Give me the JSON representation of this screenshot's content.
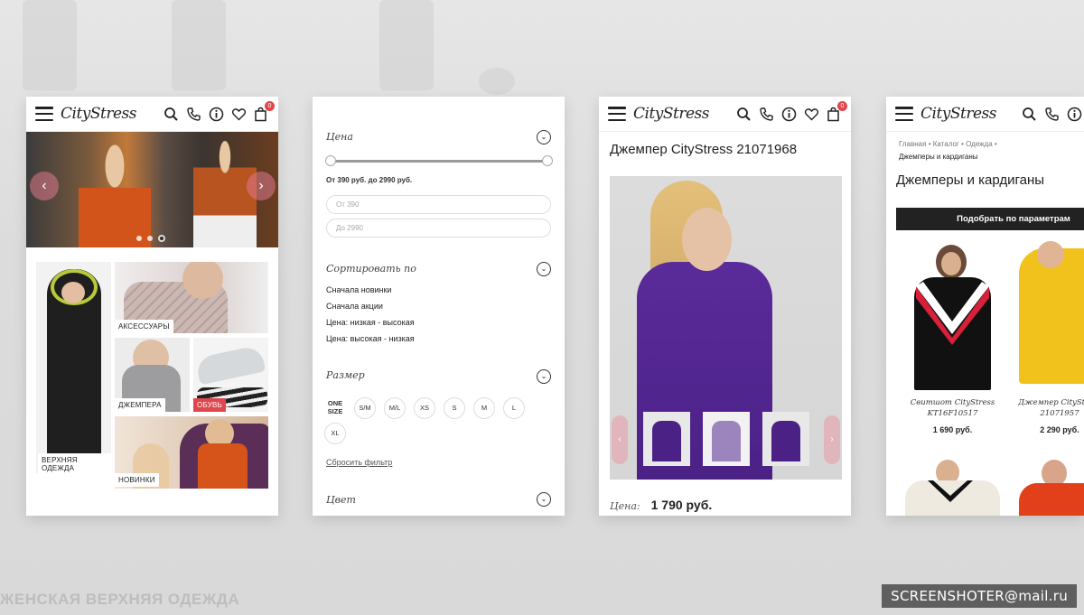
{
  "app": {
    "logo": "CityStress",
    "cart_count": "0"
  },
  "background": {
    "caption": "ЖЕНСКАЯ ВЕРХНЯЯ ОДЕЖДА",
    "watermark": "SCREENSHOTER@mail.ru"
  },
  "home": {
    "slider": {
      "prev": "‹",
      "next": "›",
      "slides": 3,
      "active_slide": 3
    },
    "tiles": [
      {
        "label": "ВЕРХНЯЯ ОДЕЖДА"
      },
      {
        "label": "АКСЕССУАРЫ"
      },
      {
        "label": "ДЖЕМПЕРА"
      },
      {
        "label": "ОБУВЬ"
      },
      {
        "label": "НОВИНКИ"
      }
    ]
  },
  "filters": {
    "price": {
      "title": "Цена",
      "range_text": "От 390 руб. до 2990 руб.",
      "from_placeholder": "От 390",
      "to_placeholder": "До 2990",
      "min": 390,
      "max": 2990
    },
    "sort": {
      "title": "Сортировать по",
      "options": [
        "Сначала новинки",
        "Сначала акции",
        "Цена: низкая - высокая",
        "Цена: высокая - низкая"
      ]
    },
    "size": {
      "title": "Размер",
      "options": [
        "ONE SIZE",
        "S/M",
        "M/L",
        "XS",
        "S",
        "M",
        "L",
        "XL"
      ]
    },
    "reset": "Сбросить фильтр",
    "color": {
      "title": "Цвет"
    }
  },
  "product": {
    "title": "Джемпер CityStress 21071968",
    "price_label": "Цена:",
    "price": "1 790 руб.",
    "prev": "‹",
    "next": "›"
  },
  "catalog": {
    "breadcrumbs": [
      "Главная",
      "Каталог",
      "Одежда",
      "Джемперы и кардиганы"
    ],
    "separator": "•",
    "title": "Джемперы и кардиганы",
    "filter_button": "Подобрать по параметрам",
    "products": [
      {
        "name": "Свитшот CityStress KT16F10517",
        "price": "1 690 руб."
      },
      {
        "name": "Джемпер CityStress 21071957",
        "price": "2 290 руб."
      }
    ]
  },
  "colors": {
    "accent": "#e0474c",
    "purple": "#4b2186",
    "dark": "#222222"
  }
}
